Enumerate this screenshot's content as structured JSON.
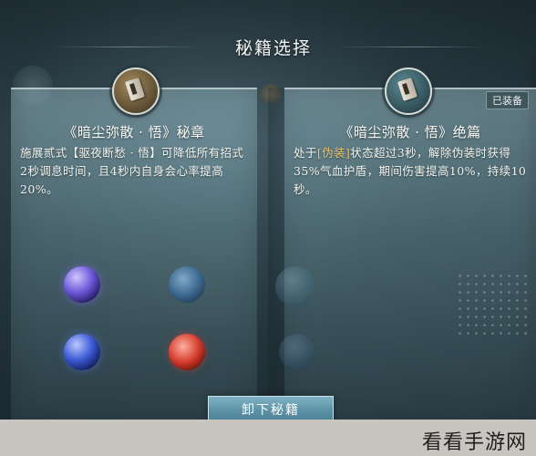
{
  "title": "秘籍选择",
  "left_card": {
    "name": "《暗尘弥散 · 悟》秘章",
    "description": "施展贰式【驱夜断愁 · 悟】可降低所有招式2秒调息时间，且4秒内自身会心率提高20%。",
    "icon": "book-icon"
  },
  "right_card": {
    "name": "《暗尘弥散 · 悟》绝篇",
    "badge": "已装备",
    "desc_before": "处于",
    "desc_highlight": "[伪装]",
    "desc_after": "状态超过3秒，解除伪装时获得35%气血护盾，期间伤害提高10%，持续10秒。",
    "icon": "book-icon"
  },
  "unequip_button": "卸下秘籍",
  "watermark": "看看手游网",
  "colors": {
    "highlight": "#e9c56a",
    "panel": "#8fb0ba",
    "button": "#5a8fa3"
  }
}
